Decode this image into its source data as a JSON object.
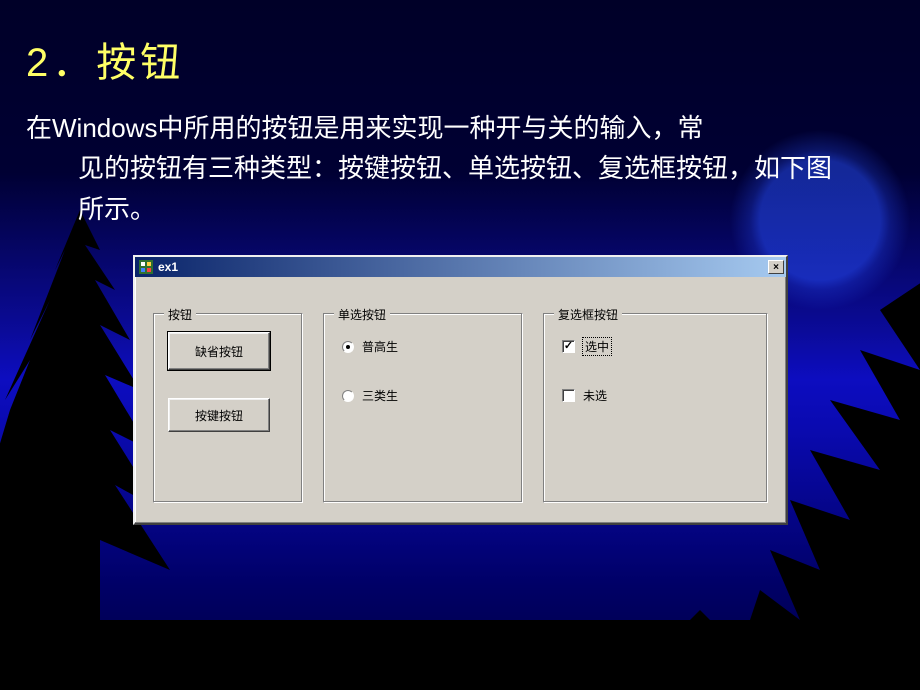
{
  "slide": {
    "title": "2．按钮",
    "paragraph_line1": "在Windows中所用的按钮是用来实现一种开与关的输入，常",
    "paragraph_line2": "见的按钮有三种类型：按键按钮、单选按钮、复选框按钮，如下图所示。"
  },
  "window": {
    "title": "ex1",
    "close_label": "×",
    "group_button": {
      "legend": "按钮",
      "default_button": "缺省按钮",
      "push_button": "按键按钮"
    },
    "group_radio": {
      "legend": "单选按钮",
      "options": [
        {
          "label": "普高生",
          "selected": true
        },
        {
          "label": "三类生",
          "selected": false
        }
      ]
    },
    "group_check": {
      "legend": "复选框按钮",
      "options": [
        {
          "label": "选中",
          "checked": true,
          "focused": true
        },
        {
          "label": "未选",
          "checked": false,
          "focused": false
        }
      ]
    }
  }
}
